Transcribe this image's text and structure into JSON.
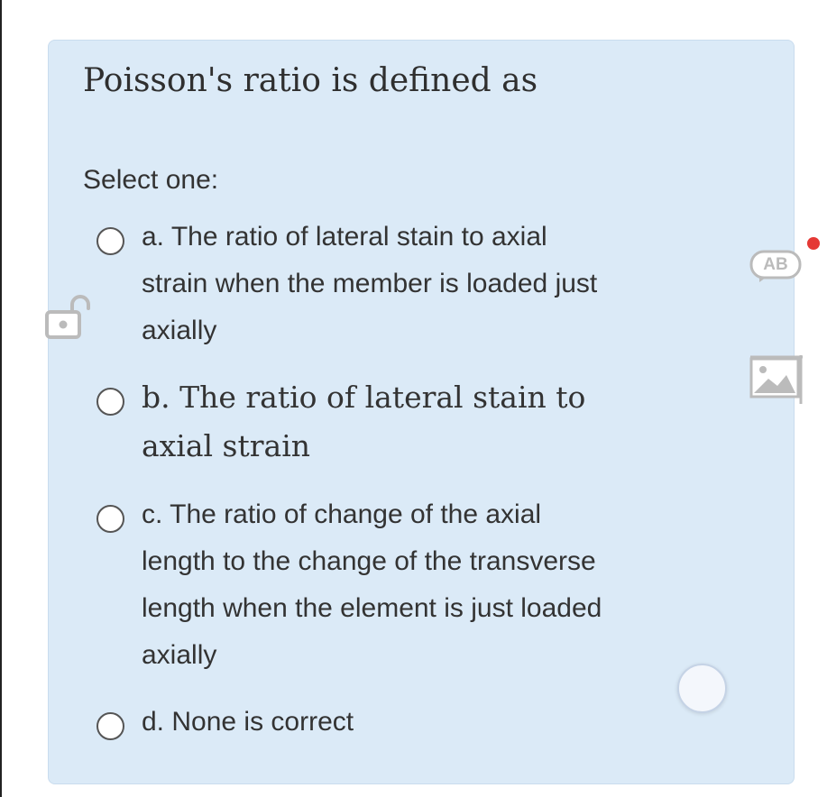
{
  "quiz": {
    "question": "Poisson's ratio is defined as",
    "select_label": "Select one:",
    "options": [
      {
        "letter": "a.",
        "text": "The ratio of lateral stain to axial strain when the member is loaded just axially",
        "lines": [
          "a. The ratio of lateral stain to axial",
          "strain when the member is loaded just",
          "axially"
        ]
      },
      {
        "letter": "b.",
        "text": "The ratio of lateral stain to axial strain",
        "lines": [
          "b. The ratio of lateral stain to",
          "axial strain"
        ]
      },
      {
        "letter": "c.",
        "text": "The ratio of change of the axial length to the change of the transverse length when the element is just loaded axially",
        "lines": [
          "c. The ratio of change of the axial",
          "length to the change of the transverse",
          "length when the element is just loaded",
          "axially"
        ]
      },
      {
        "letter": "d.",
        "text": "None is correct",
        "lines": [
          "d. None is correct"
        ]
      }
    ]
  },
  "overlay": {
    "translate_badge": "AB",
    "icons": [
      "lock-open-icon",
      "translate-icon",
      "image-icon",
      "notification-dot",
      "floating-button"
    ]
  },
  "colors": {
    "card_background": "#dbeaf7",
    "text": "#333333",
    "radio_border": "#555555",
    "notification_dot": "#e53935"
  }
}
